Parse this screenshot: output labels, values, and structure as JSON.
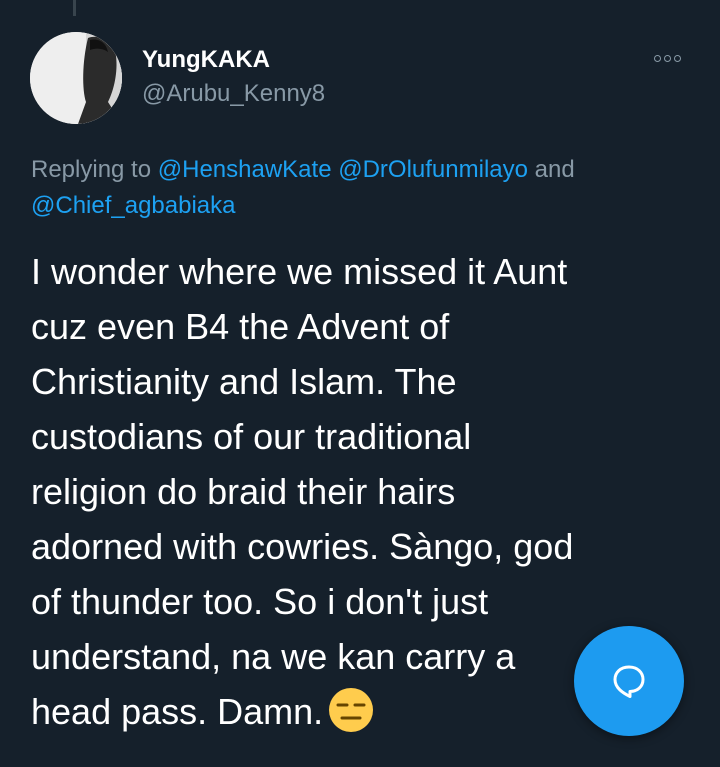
{
  "author": {
    "name": "YungKAKA",
    "handle": "@Arubu_Kenny8"
  },
  "reply": {
    "prefix": "Replying to ",
    "mention1": "@HenshawKate",
    "mention2": "@DrOlufunmilayo",
    "conjunction": " and",
    "mention3": "@Chief_agbabiaka"
  },
  "tweet": {
    "lines": [
      "I wonder where we missed it Aunt",
      "cuz even B4 the Advent of",
      "Christianity and Islam. The",
      "custodians of our traditional",
      "religion do braid their hairs",
      "adorned with cowries. Sàngo, god",
      "of thunder too. So i don't just",
      "understand, na we kan carry a",
      "head pass. Damn."
    ],
    "emoji": "expressionless-face"
  },
  "icons": {
    "more": "more-options-icon",
    "compose": "chat-bubble-icon"
  },
  "colors": {
    "background": "#15202b",
    "text": "#ffffff",
    "secondary": "#8899a6",
    "accent": "#1da1f2",
    "fab": "#1d9bf0"
  }
}
